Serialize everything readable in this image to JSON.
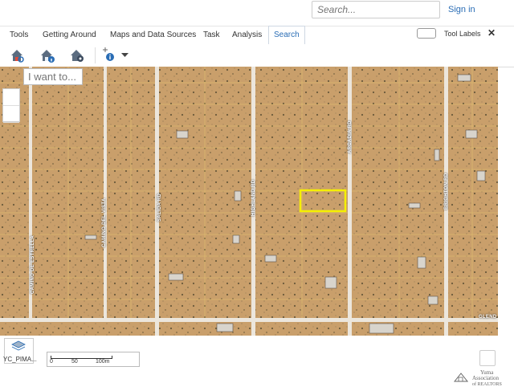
{
  "header": {
    "search_placeholder": "Search...",
    "sign_in": "Sign in"
  },
  "tabs": [
    {
      "label": "Tools"
    },
    {
      "label": "Getting Around"
    },
    {
      "label": "Maps and Data Sources"
    },
    {
      "label": "Task"
    },
    {
      "label": "Analysis"
    },
    {
      "label": "Search",
      "active": true
    }
  ],
  "tool_labels": "Tool Labels",
  "close_glyph": "✕",
  "toolbar": {
    "icons": [
      "house-search-icon",
      "house-info-icon",
      "house-gear-icon",
      "identify-icon",
      "dropdown-icon"
    ]
  },
  "map": {
    "i_want_to": "I want to...",
    "roads": [
      "CAMINO DE ESTRELLA",
      "CAMINO DEL VISTA",
      "SALIDA RD",
      "HIGHLAND RD",
      "ARCADIA RD",
      "BRIGHTON RD",
      "GLEND"
    ],
    "highlight_color": "#f5f000"
  },
  "layer": {
    "label": "YC_PIMA..."
  },
  "scale": {
    "labels": [
      "0",
      "50",
      "100m"
    ]
  },
  "logo": {
    "line1": "Yuma",
    "line2": "Association",
    "line3": "of REALTORS"
  }
}
